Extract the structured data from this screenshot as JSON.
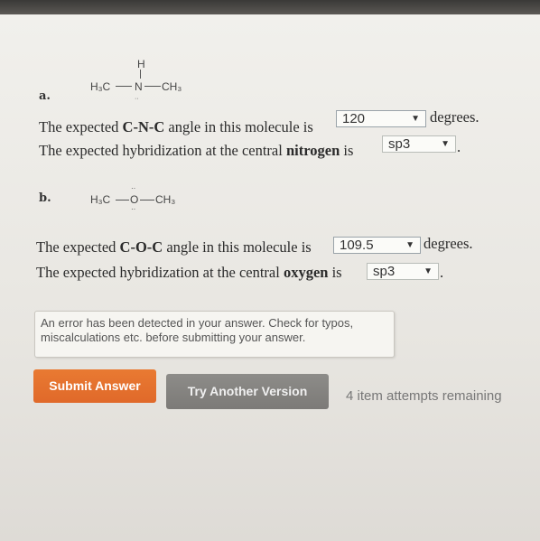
{
  "part_a": {
    "label": "a.",
    "molecule": {
      "left": "H₃C",
      "center": "N",
      "top": "H",
      "right": "CH₃"
    },
    "line1_prefix": "The expected ",
    "line1_bold": "C-N-C",
    "line1_suffix": " angle in this molecule is",
    "angle_value": "120",
    "angle_unit": "degrees.",
    "line2_prefix": "The expected hybridization at the central ",
    "line2_bold": "nitrogen",
    "line2_suffix": " is",
    "hybridization_value": "sp3",
    "line2_end": "."
  },
  "part_b": {
    "label": "b.",
    "molecule": {
      "left": "H₃C",
      "center": "O",
      "right": "CH₃"
    },
    "line1_prefix": "The expected ",
    "line1_bold": "C-O-C",
    "line1_suffix": " angle in this molecule is",
    "angle_value": "109.5",
    "angle_unit": "degrees.",
    "line2_prefix": "The expected hybridization at the central ",
    "line2_bold": "oxygen",
    "line2_suffix": " is",
    "hybridization_value": "sp3",
    "line2_end": "."
  },
  "error_message": {
    "line1": "An error has been detected in your answer. Check for typos,",
    "line2": "miscalculations etc. before submitting your answer."
  },
  "buttons": {
    "submit": "Submit Answer",
    "try_another": "Try Another Version"
  },
  "attempts_text": "4 item attempts remaining",
  "colors": {
    "submit": "#e0692a",
    "try_another": "#7f7e7b",
    "page_bg": "#eceae5"
  },
  "icons": {
    "dropdown": "triangle-down-icon"
  }
}
